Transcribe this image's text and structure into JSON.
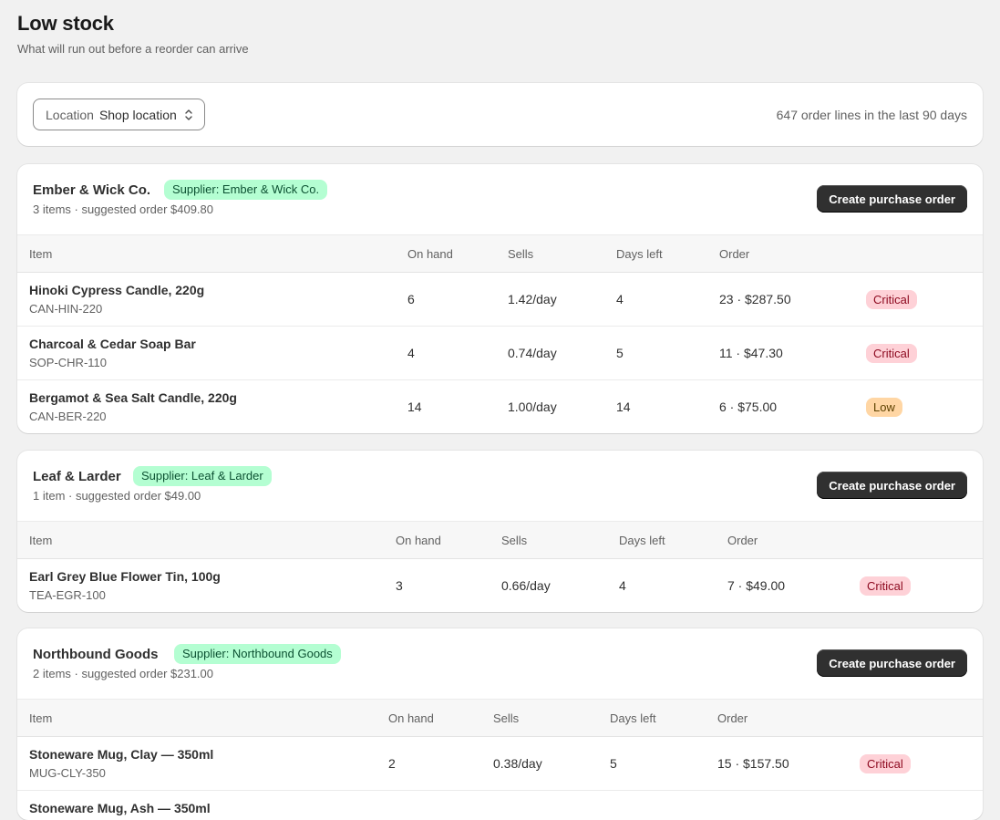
{
  "page": {
    "title": "Low stock",
    "subtitle": "What will run out before a reorder can arrive"
  },
  "filter": {
    "location_label": "Location",
    "location_value": "Shop location",
    "order_lines_text": "647 order lines in the last 90 days"
  },
  "table_headers": {
    "item": "Item",
    "on_hand": "On hand",
    "sells": "Sells",
    "days_left": "Days left",
    "order": "Order"
  },
  "suppliers": [
    {
      "name": "Ember & Wick Co.",
      "badge": "Supplier: Ember & Wick Co.",
      "summary": "3 items · suggested order $409.80",
      "button_label": "Create purchase order",
      "rows": [
        {
          "name": "Hinoki Cypress Candle, 220g",
          "sku": "CAN-HIN-220",
          "on_hand": "6",
          "sells": "1.42/day",
          "days_left": "4",
          "order": "23 · $287.50",
          "status": "Critical"
        },
        {
          "name": "Charcoal & Cedar Soap Bar",
          "sku": "SOP-CHR-110",
          "on_hand": "4",
          "sells": "0.74/day",
          "days_left": "5",
          "order": "11 · $47.30",
          "status": "Critical"
        },
        {
          "name": "Bergamot & Sea Salt Candle, 220g",
          "sku": "CAN-BER-220",
          "on_hand": "14",
          "sells": "1.00/day",
          "days_left": "14",
          "order": "6 · $75.00",
          "status": "Low"
        }
      ]
    },
    {
      "name": "Leaf & Larder",
      "badge": "Supplier: Leaf & Larder",
      "summary": "1 item · suggested order $49.00",
      "button_label": "Create purchase order",
      "rows": [
        {
          "name": "Earl Grey Blue Flower Tin, 100g",
          "sku": "TEA-EGR-100",
          "on_hand": "3",
          "sells": "0.66/day",
          "days_left": "4",
          "order": "7 · $49.00",
          "status": "Critical"
        }
      ]
    },
    {
      "name": "Northbound Goods",
      "badge": "Supplier: Northbound Goods",
      "summary": "2 items · suggested order $231.00",
      "button_label": "Create purchase order",
      "rows": [
        {
          "name": "Stoneware Mug, Clay — 350ml",
          "sku": "MUG-CLY-350",
          "on_hand": "2",
          "sells": "0.38/day",
          "days_left": "5",
          "order": "15 · $157.50",
          "status": "Critical"
        },
        {
          "name": "Stoneware Mug, Ash — 350ml",
          "sku": "",
          "on_hand": "",
          "sells": "",
          "days_left": "",
          "order": "",
          "status": ""
        }
      ]
    }
  ],
  "colors": {
    "critical_bg": "#fed1d7",
    "low_bg": "#ffd6a4",
    "supplier_badge_bg": "#b4fed2",
    "primary_button": "#303030"
  }
}
